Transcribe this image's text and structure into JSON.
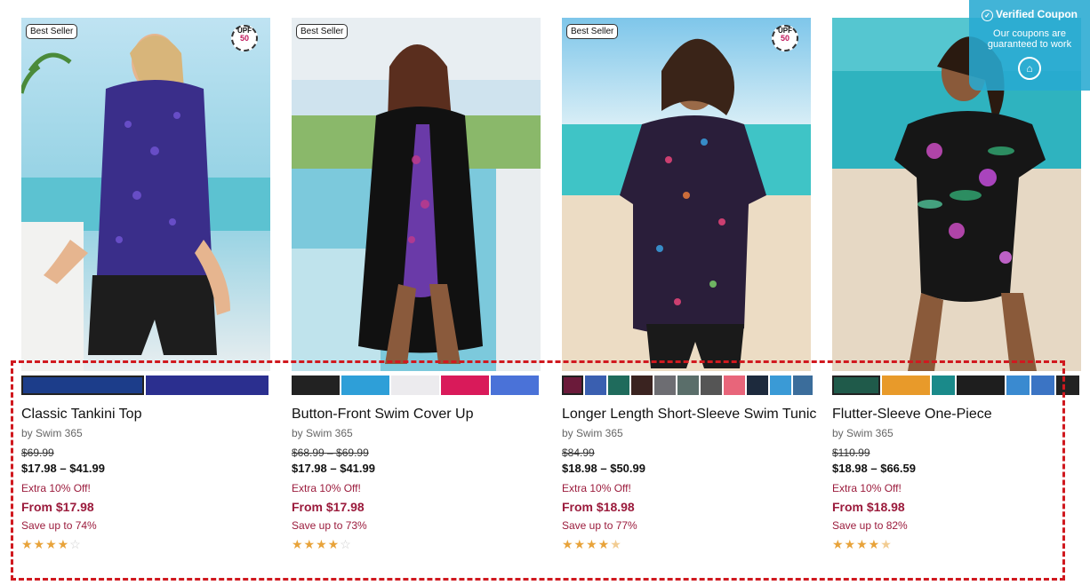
{
  "products": [
    {
      "badge": "Best Seller",
      "upf": {
        "label": "UPF",
        "value": "50"
      },
      "swatches": [
        "#1c3d8a",
        "#2b2f8f"
      ],
      "title": "Classic Tankini Top",
      "brand": "by Swim 365",
      "original_price": "$69.99",
      "price_range": "$17.98 – $41.99",
      "promo": "Extra 10% Off!",
      "from_price": "From $17.98",
      "savings": "Save up to 74%",
      "rating_stars": 4
    },
    {
      "badge": "Best Seller",
      "upf": null,
      "swatches": [
        "#222222",
        "#2e9fd8",
        "#ecebee",
        "#d91a5a",
        "#4a72d8"
      ],
      "title": "Button-Front Swim Cover Up",
      "brand": "by Swim 365",
      "original_price": "$68.99 – $69.99",
      "price_range": "$17.98 – $41.99",
      "promo": "Extra 10% Off!",
      "from_price": "From $17.98",
      "savings": "Save up to 73%",
      "rating_stars": 4
    },
    {
      "badge": "Best Seller",
      "upf": {
        "label": "UPF",
        "value": "50"
      },
      "swatches": [
        "#6b1a3a",
        "#3a5fb0",
        "#1f6b5c",
        "#3a2320",
        "#6d6d72",
        "#5a6e6a",
        "#555555",
        "#e8657a",
        "#1d2a3d",
        "#3a9ad6",
        "#3b6d9b"
      ],
      "title": "Longer Length Short-Sleeve Swim Tunic",
      "brand": "by Swim 365",
      "original_price": "$84.99",
      "price_range": "$18.98 – $50.99",
      "promo": "Extra 10% Off!",
      "from_price": "From $18.98",
      "savings": "Save up to 77%",
      "rating_stars": 4.5
    },
    {
      "badge": null,
      "upf": null,
      "swatches": [
        "#1f5a4a",
        "#e89a2a",
        "#1a8a8a",
        "#1e1e1e",
        "#3a8ad0",
        "#3b74c4",
        "#222222"
      ],
      "title": "Flutter-Sleeve One-Piece",
      "brand": "by Swim 365",
      "original_price": "$110.99",
      "price_range": "$18.98 – $66.59",
      "promo": "Extra 10% Off!",
      "from_price": "From $18.98",
      "savings": "Save up to 82%",
      "rating_stars": 4.5
    }
  ],
  "coupon_widget": {
    "title": "Verified Coupon",
    "subtitle": "Our coupons are guaranteed to work",
    "check_icon": "check-circle-icon",
    "home_icon": "home-icon"
  },
  "colors": {
    "sale_red": "#9b1b3c",
    "star_gold": "#e8a33a",
    "highlight_red": "#d0191f",
    "coupon_blue": "#28aad2"
  }
}
